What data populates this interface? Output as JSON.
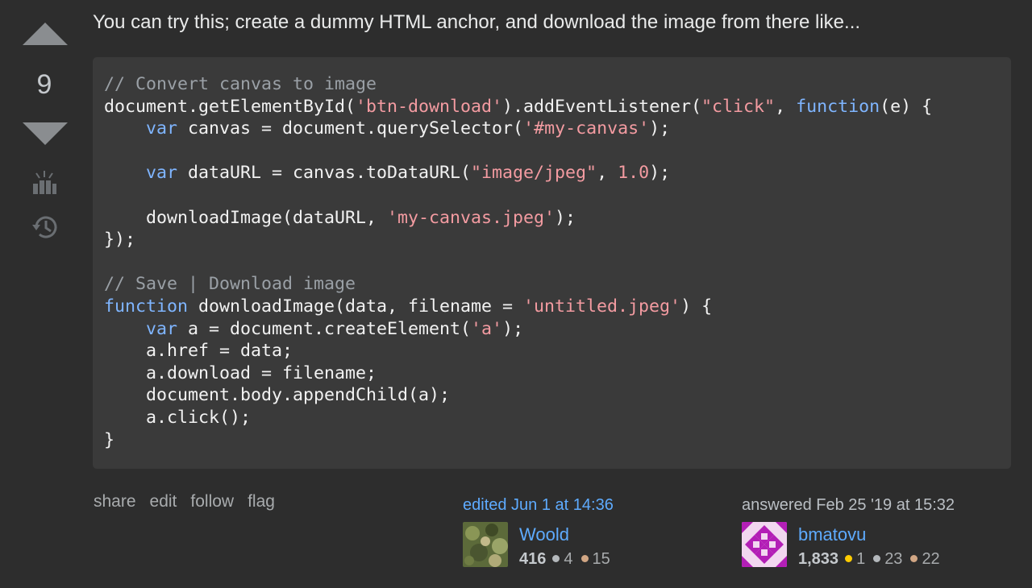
{
  "vote": {
    "count": "9"
  },
  "post": {
    "text": "You can try this; create a dummy HTML anchor, and download the image from there like...",
    "code_lines": [
      [
        {
          "t": "comment",
          "v": "// Convert canvas to image"
        }
      ],
      [
        {
          "t": "plain",
          "v": "document.getElementById("
        },
        {
          "t": "string",
          "v": "'btn-download'"
        },
        {
          "t": "plain",
          "v": ").addEventListener("
        },
        {
          "t": "string",
          "v": "\"click\""
        },
        {
          "t": "plain",
          "v": ", "
        },
        {
          "t": "keyword",
          "v": "function"
        },
        {
          "t": "plain",
          "v": "(e) {"
        }
      ],
      [
        {
          "t": "plain",
          "v": "    "
        },
        {
          "t": "keyword",
          "v": "var"
        },
        {
          "t": "plain",
          "v": " canvas = document.querySelector("
        },
        {
          "t": "string",
          "v": "'#my-canvas'"
        },
        {
          "t": "plain",
          "v": ");"
        }
      ],
      [
        {
          "t": "plain",
          "v": ""
        }
      ],
      [
        {
          "t": "plain",
          "v": "    "
        },
        {
          "t": "keyword",
          "v": "var"
        },
        {
          "t": "plain",
          "v": " dataURL = canvas.toDataURL("
        },
        {
          "t": "string",
          "v": "\"image/jpeg\""
        },
        {
          "t": "plain",
          "v": ", "
        },
        {
          "t": "number",
          "v": "1.0"
        },
        {
          "t": "plain",
          "v": ");"
        }
      ],
      [
        {
          "t": "plain",
          "v": ""
        }
      ],
      [
        {
          "t": "plain",
          "v": "    downloadImage(dataURL, "
        },
        {
          "t": "string",
          "v": "'my-canvas.jpeg'"
        },
        {
          "t": "plain",
          "v": ");"
        }
      ],
      [
        {
          "t": "plain",
          "v": "});"
        }
      ],
      [
        {
          "t": "plain",
          "v": ""
        }
      ],
      [
        {
          "t": "comment",
          "v": "// Save | Download image"
        }
      ],
      [
        {
          "t": "keyword",
          "v": "function"
        },
        {
          "t": "plain",
          "v": " downloadImage(data, filename = "
        },
        {
          "t": "string",
          "v": "'untitled.jpeg'"
        },
        {
          "t": "plain",
          "v": ") {"
        }
      ],
      [
        {
          "t": "plain",
          "v": "    "
        },
        {
          "t": "keyword",
          "v": "var"
        },
        {
          "t": "plain",
          "v": " a = document.createElement("
        },
        {
          "t": "string",
          "v": "'a'"
        },
        {
          "t": "plain",
          "v": ");"
        }
      ],
      [
        {
          "t": "plain",
          "v": "    a.href = data;"
        }
      ],
      [
        {
          "t": "plain",
          "v": "    a.download = filename;"
        }
      ],
      [
        {
          "t": "plain",
          "v": "    document.body.appendChild(a);"
        }
      ],
      [
        {
          "t": "plain",
          "v": "    a.click();"
        }
      ],
      [
        {
          "t": "plain",
          "v": "}"
        }
      ]
    ]
  },
  "menu": {
    "share": "share",
    "edit": "edit",
    "follow": "follow",
    "flag": "flag"
  },
  "editor": {
    "action": "edited Jun 1 at 14:36",
    "name": "Woold",
    "reputation": "416",
    "silver": "4",
    "bronze": "15"
  },
  "owner": {
    "action": "answered Feb 25 '19 at 15:32",
    "name": "bmatovu",
    "reputation": "1,833",
    "gold": "1",
    "silver": "23",
    "bronze": "22"
  },
  "colors": {
    "background": "#2d2d2d",
    "code_background": "#3a3a3a",
    "link": "#5eabff",
    "keyword": "#7fb5ff",
    "string": "#f39ba1",
    "comment": "#9aa0a6"
  },
  "icons": [
    "vote-up-icon",
    "vote-down-icon",
    "bounty-icon",
    "history-icon"
  ]
}
